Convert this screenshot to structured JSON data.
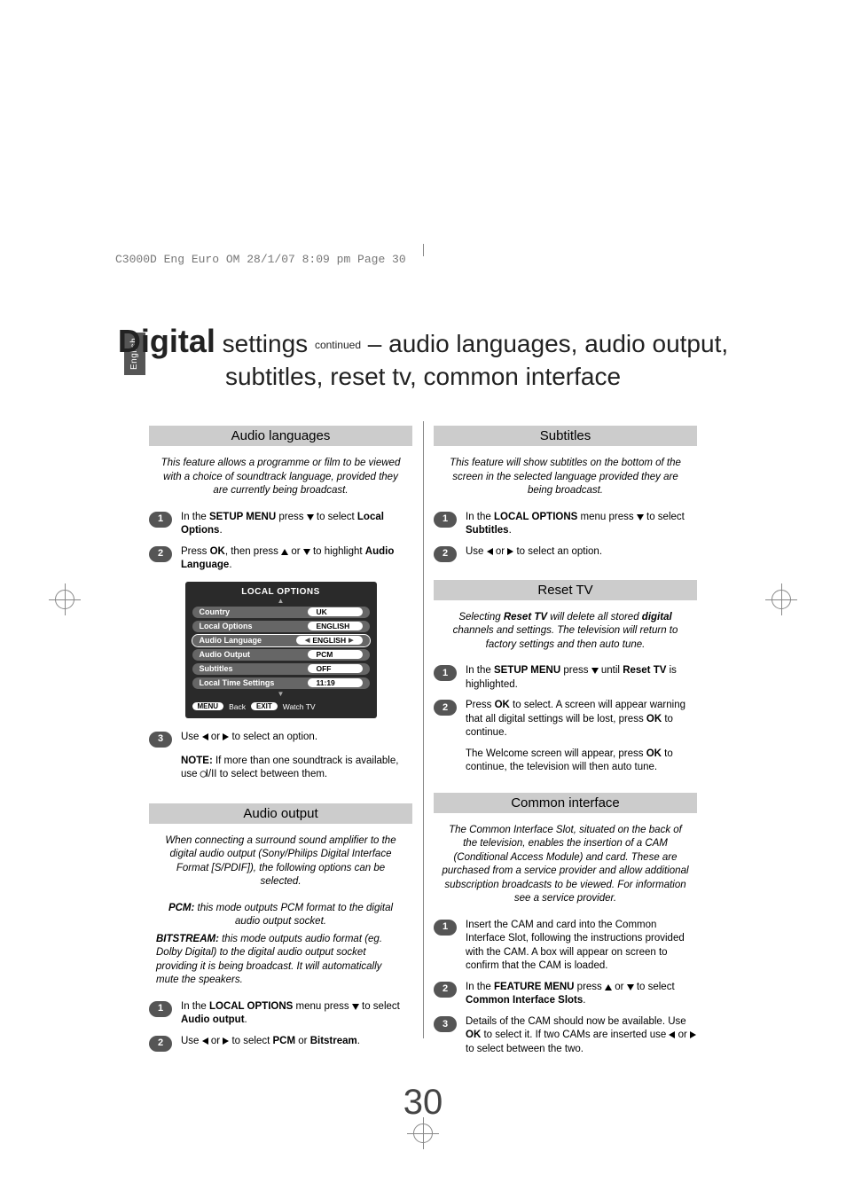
{
  "meta": {
    "header": "C3000D Eng Euro OM  28/1/07  8:09 pm  Page 30",
    "side_tab": "English",
    "page_number": "30"
  },
  "title": {
    "digital": "Digital",
    "settings": " settings ",
    "continued": "continued",
    "rest": " – audio languages, audio output, subtitles, reset tv, common interface"
  },
  "audio_lang": {
    "heading": "Audio languages",
    "intro": "This feature allows a programme or film to be viewed with a choice of soundtrack language, provided they are currently being broadcast.",
    "step1_a": "In the ",
    "step1_b": "SETUP MENU",
    "step1_c": " press ",
    "step1_d": " to select ",
    "step1_e": "Local Options",
    "step1_f": ".",
    "step2_a": "Press ",
    "step2_b": "OK",
    "step2_c": ", then press ",
    "step2_d": " or ",
    "step2_e": " to highlight ",
    "step2_f": "Audio Language",
    "step2_g": ".",
    "step3_a": "Use ",
    "step3_b": " or ",
    "step3_c": " to select an option.",
    "note_a": "NOTE:",
    "note_b": " If more than one soundtrack is available, use ",
    "note_c": "I/II",
    "note_d": " to select between them."
  },
  "local_options_menu": {
    "title": "LOCAL OPTIONS",
    "rows": [
      {
        "label": "Country",
        "value": "UK"
      },
      {
        "label": "Local Options",
        "value": "ENGLISH"
      },
      {
        "label": "Audio Language",
        "value": "ENGLISH",
        "selected": true,
        "chev": true
      },
      {
        "label": "Audio Output",
        "value": "PCM"
      },
      {
        "label": "Subtitles",
        "value": "OFF"
      },
      {
        "label": "Local Time Settings",
        "value": "11:19"
      }
    ],
    "footer": {
      "menu": "MENU",
      "back": "Back",
      "exit": "EXIT",
      "watch": "Watch TV"
    }
  },
  "audio_output": {
    "heading": "Audio output",
    "intro": "When connecting a surround sound amplifier to the digital audio output (Sony/Philips Digital Interface Format [S/PDIF]), the following options can be selected.",
    "pcm_a": "PCM:",
    "pcm_b": " this mode outputs PCM format to the digital audio output socket.",
    "bit_a": "BITSTREAM:",
    "bit_b": " this mode outputs audio format (eg. Dolby Digital) to the digital audio output socket providing it is being broadcast. It will automatically mute the speakers.",
    "step1_a": "In the ",
    "step1_b": "LOCAL OPTIONS",
    "step1_c": " menu press ",
    "step1_d": " to select ",
    "step1_e": "Audio output",
    "step1_f": ".",
    "step2_a": "Use ",
    "step2_b": " or ",
    "step2_c": " to select ",
    "step2_d": "PCM",
    "step2_e": " or ",
    "step2_f": "Bitstream",
    "step2_g": "."
  },
  "subtitles": {
    "heading": "Subtitles",
    "intro": "This feature will show subtitles on the bottom of the screen in the selected language provided they are being broadcast.",
    "step1_a": "In the ",
    "step1_b": "LOCAL OPTIONS",
    "step1_c": " menu press ",
    "step1_d": " to select ",
    "step1_e": "Subtitles",
    "step1_f": ".",
    "step2_a": "Use ",
    "step2_b": " or ",
    "step2_c": " to select an option."
  },
  "reset": {
    "heading": "Reset TV",
    "intro_a": "Selecting ",
    "intro_b": "Reset TV",
    "intro_c": " will delete all stored ",
    "intro_d": "digital",
    "intro_e": " channels and settings. The television will return to factory settings and then auto tune.",
    "step1_a": "In the ",
    "step1_b": "SETUP MENU",
    "step1_c": " press ",
    "step1_d": " until ",
    "step1_e": "Reset TV",
    "step1_f": " is highlighted.",
    "step2_a": "Press ",
    "step2_b": "OK",
    "step2_c": " to select. A screen will appear warning that all digital settings will be lost, press ",
    "step2_d": "OK",
    "step2_e": " to continue.",
    "step3_a": "The Welcome screen will appear, press ",
    "step3_b": "OK",
    "step3_c": " to continue, the television will then auto tune."
  },
  "ci": {
    "heading": "Common interface",
    "intro": "The Common Interface Slot, situated on the back of the television, enables the insertion of a CAM (Conditional Access Module) and card. These are purchased from a service provider and allow additional subscription broadcasts to be viewed. For information see a service provider.",
    "step1": "Insert the CAM and card into the Common Interface Slot, following the instructions provided with the CAM. A box will appear on screen to confirm that the CAM is loaded.",
    "step2_a": "In the ",
    "step2_b": "FEATURE MENU",
    "step2_c": " press ",
    "step2_d": " or ",
    "step2_e": " to select ",
    "step2_f": "Common Interface Slots",
    "step2_g": ".",
    "step3_a": "Details of the CAM should now be available. Use ",
    "step3_b": "OK",
    "step3_c": " to select it. If two CAMs are inserted use ",
    "step3_d": " or ",
    "step3_e": " to select between the two."
  },
  "badges": {
    "n1": "1",
    "n2": "2",
    "n3": "3"
  }
}
